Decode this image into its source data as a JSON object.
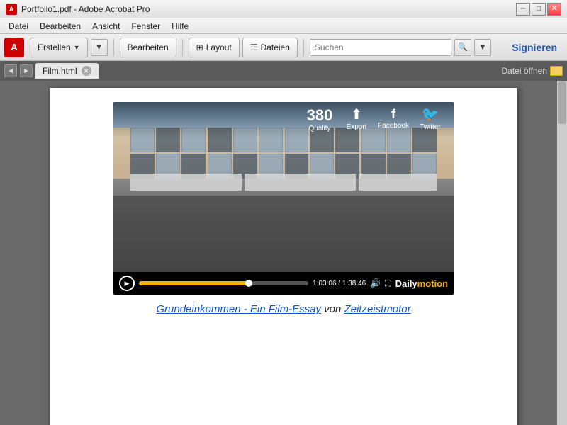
{
  "titlebar": {
    "icon_label": "A",
    "title": "Portfolio1.pdf - Adobe Acrobat Pro",
    "min_btn": "─",
    "max_btn": "□",
    "close_btn": "✕"
  },
  "menubar": {
    "items": [
      "Datei",
      "Bearbeiten",
      "Ansicht",
      "Fenster",
      "Hilfe"
    ]
  },
  "toolbar": {
    "erstellen_label": "Erstellen",
    "bearbeiten_label": "Bearbeiten",
    "layout_label": "Layout",
    "dateien_label": "Dateien",
    "search_placeholder": "Suchen",
    "signieren_label": "Signieren"
  },
  "tabbar": {
    "tab_label": "Film.html",
    "datei_oeffnen_label": "Datei öffnen"
  },
  "video": {
    "quality_number": "380",
    "quality_label": "Quality",
    "export_label": "Export",
    "facebook_label": "Facebook",
    "twitter_label": "Twitter",
    "time_current": "1:03:06",
    "time_total": "1:38:46",
    "progress_percent": 65
  },
  "caption": {
    "part1": "Grundeinkommen - Ein Film-Essay",
    "part2": " von ",
    "part3": "Zeitzeistmotor"
  }
}
